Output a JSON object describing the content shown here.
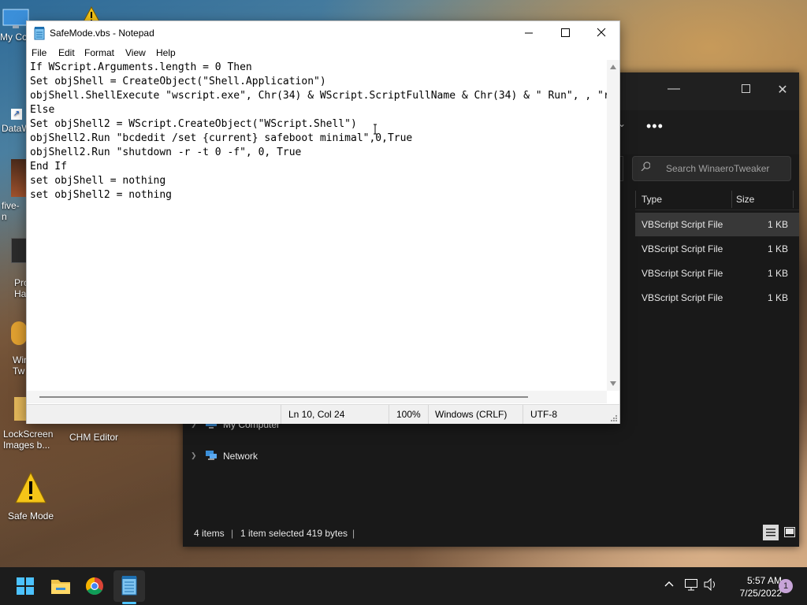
{
  "desktop": {
    "icons": [
      {
        "label": "My Co",
        "name": "desktop-icon-my-computer"
      },
      {
        "label": "DataW",
        "name": "desktop-icon-dataw"
      },
      {
        "label": "five-n",
        "name": "desktop-icon-five-n"
      },
      {
        "label": "Pro Ha",
        "name": "desktop-icon-pro-ha"
      },
      {
        "label": "Win Tw",
        "name": "desktop-icon-win-tw"
      },
      {
        "label": "LockScreen Images b...",
        "name": "desktop-icon-lockscreen-images"
      },
      {
        "label": "CHM Editor",
        "name": "desktop-icon-chm-editor"
      },
      {
        "label": "Safe Mode",
        "name": "desktop-icon-safe-mode"
      }
    ]
  },
  "explorer": {
    "search_placeholder": "Search WinaeroTweaker",
    "more_label": "•••",
    "nav": [
      {
        "label": "My Computer"
      },
      {
        "label": "Network"
      }
    ],
    "columns": {
      "type": "Type",
      "size": "Size"
    },
    "rows": [
      {
        "type": "VBScript Script File",
        "size": "1 KB",
        "selected": true
      },
      {
        "type": "VBScript Script File",
        "size": "1 KB",
        "selected": false
      },
      {
        "type": "VBScript Script File",
        "size": "1 KB",
        "selected": false
      },
      {
        "type": "VBScript Script File",
        "size": "1 KB",
        "selected": false
      }
    ],
    "status": {
      "items": "4 items",
      "sep": "|",
      "selected": "1 item selected",
      "bytes": "419 bytes"
    }
  },
  "notepad": {
    "title": "SafeMode.vbs - Notepad",
    "menu": [
      "File",
      "Edit",
      "Format",
      "View",
      "Help"
    ],
    "lines": [
      "If WScript.Arguments.length = 0 Then",
      "Set objShell = CreateObject(\"Shell.Application\")",
      "objShell.ShellExecute \"wscript.exe\", Chr(34) & WScript.ScriptFullName & Chr(34) & \" Run\", , \"r",
      "Else",
      "Set objShell2 = WScript.CreateObject(\"WScript.Shell\")",
      "objShell2.Run \"bcdedit /set {current} safeboot minimal\",0,True",
      "objShell2.Run \"shutdown -r -t 0 -f\", 0, True",
      "End If",
      "set objShell = nothing",
      "set objShell2 = nothing"
    ],
    "status": {
      "position": "Ln 10, Col 24",
      "zoom": "100%",
      "eol": "Windows (CRLF)",
      "encoding": "UTF-8"
    }
  },
  "taskbar": {
    "apps": [
      {
        "name": "start-button-icon"
      },
      {
        "name": "file-explorer-icon"
      },
      {
        "name": "chrome-icon"
      },
      {
        "name": "notepad-icon",
        "active": true
      }
    ],
    "time": "5:57 AM",
    "date": "7/25/2022",
    "notification_count": "1"
  },
  "colors": {
    "accent": "#4cc2ff",
    "explorer_bg": "#191919",
    "taskbar_bg": "#1c1c1c"
  }
}
